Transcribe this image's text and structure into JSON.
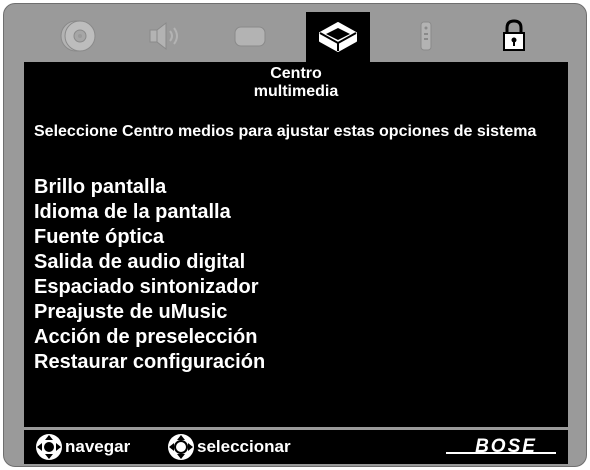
{
  "tabs": [
    {
      "icon": "disc-icon",
      "active": false
    },
    {
      "icon": "speaker-icon",
      "active": false
    },
    {
      "icon": "screen-icon",
      "active": false
    },
    {
      "icon": "media-center-icon",
      "active": true
    },
    {
      "icon": "remote-icon",
      "active": false
    },
    {
      "icon": "lock-icon",
      "active": false
    }
  ],
  "screen": {
    "title_line1": "Centro",
    "title_line2": "multimedia",
    "description": "Seleccione Centro medios para ajustar estas opciones de sistema",
    "menu": [
      "Brillo pantalla",
      "Idioma de la pantalla",
      "Fuente óptica",
      "Salida de audio digital",
      "Espaciado sintonizador",
      "Preajuste de uMusic",
      "Acción de preselección",
      "Restaurar configuración"
    ]
  },
  "footer": {
    "navigate_label": "navegar",
    "select_label": "seleccionar",
    "brand": "BOSE"
  },
  "colors": {
    "frame": "#9a9a9a",
    "screen": "#000000",
    "text": "#ffffff",
    "inactive_icon": "#aeaeae"
  }
}
